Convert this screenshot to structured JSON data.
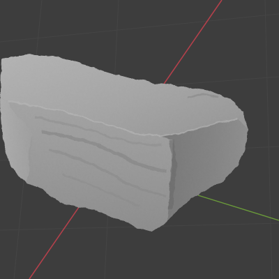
{
  "viewport": {
    "background": "#3d3d3d",
    "grid_color": "#454545",
    "x_axis_color": "#b3404b",
    "y_axis_color": "#6a9a3a",
    "object_color": "#9c9c9c",
    "object": "rock-mesh"
  }
}
